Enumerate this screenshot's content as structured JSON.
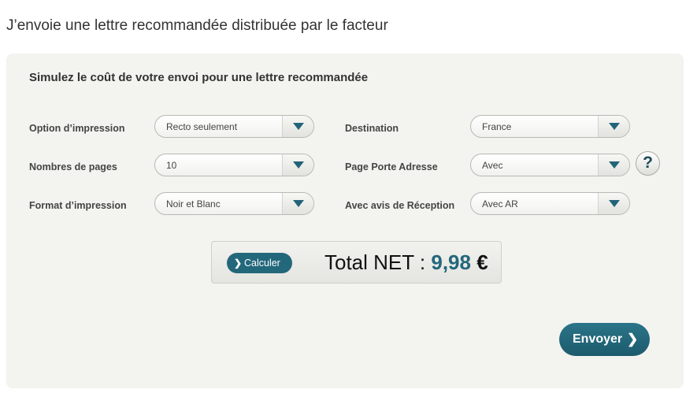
{
  "page": {
    "title": "J’envoie une lettre recommandée distribuée par le facteur"
  },
  "simulator": {
    "heading": "Simulez le coût de votre envoi pour une lettre recommandée",
    "fields": {
      "print_option": {
        "label": "Option d’impression",
        "value": "Recto seulement"
      },
      "page_count": {
        "label": "Nombres de pages",
        "value": "10"
      },
      "print_format": {
        "label": "Format d’impression",
        "value": "Noir et Blanc"
      },
      "destination": {
        "label": "Destination",
        "value": "France"
      },
      "address_page": {
        "label": "Page Porte Adresse",
        "value": "Avec"
      },
      "receipt": {
        "label": "Avec avis de Réception",
        "value": "Avec AR"
      }
    },
    "help_label": "?",
    "calculate_label": "Calculer",
    "total": {
      "prefix": "Total NET : ",
      "amount": "9,98",
      "currency": "€"
    },
    "send_label": "Envoyer"
  },
  "icons": {
    "dropdown": "chevron-down-icon",
    "calculate": "chevron-right-icon",
    "send": "chevron-right-icon"
  },
  "colors": {
    "accent": "#23677b",
    "panel_bg": "#f3f3ef"
  }
}
